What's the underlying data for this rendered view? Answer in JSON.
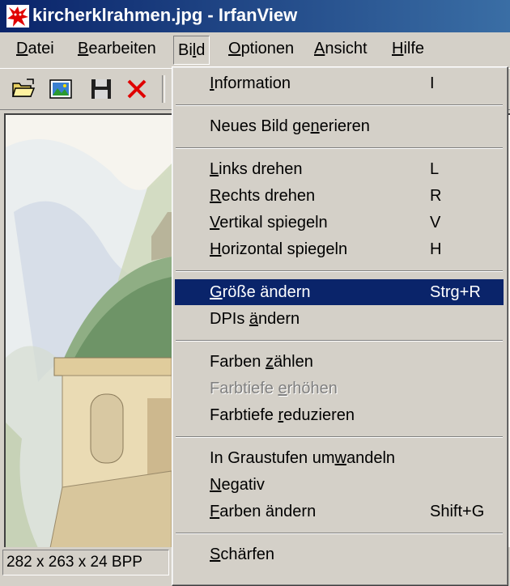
{
  "window": {
    "title": "kircherklrahmen.jpg - IrfanView",
    "icon": "irfanview-red-cat-icon"
  },
  "menubar": [
    {
      "label": "Datei",
      "mnemonic": "D"
    },
    {
      "label": "Bearbeiten",
      "mnemonic": "B"
    },
    {
      "label": "Bild",
      "mnemonic": "l",
      "open": true
    },
    {
      "label": "Optionen",
      "mnemonic": "O"
    },
    {
      "label": "Ansicht",
      "mnemonic": "A"
    },
    {
      "label": "Hilfe",
      "mnemonic": "H"
    }
  ],
  "toolbar": {
    "icons": [
      "open-folder-icon",
      "slideshow-icon",
      "save-disk-icon",
      "delete-x-icon"
    ]
  },
  "statusbar": {
    "info": "282 x 263 x 24 BPP"
  },
  "bild_menu": {
    "items": [
      {
        "label": "Information",
        "shortcut": "I",
        "mnemonic_index": 0
      },
      {
        "separator": true
      },
      {
        "label": "Neues Bild generieren",
        "shortcut": "",
        "mnemonic_index": 13
      },
      {
        "separator": true
      },
      {
        "label": "Links drehen",
        "shortcut": "L",
        "mnemonic_index": 0
      },
      {
        "label": "Rechts drehen",
        "shortcut": "R",
        "mnemonic_index": 0
      },
      {
        "label": "Vertikal spiegeln",
        "shortcut": "V",
        "mnemonic_index": 0
      },
      {
        "label": "Horizontal spiegeln",
        "shortcut": "H",
        "mnemonic_index": 0
      },
      {
        "separator": true
      },
      {
        "label": "Größe ändern",
        "shortcut": "Strg+R",
        "mnemonic_index": 0,
        "highlighted": true
      },
      {
        "label": "DPIs ändern",
        "shortcut": "",
        "mnemonic_index": 5
      },
      {
        "separator": true
      },
      {
        "label": "Farben zählen",
        "shortcut": "",
        "mnemonic_index": 7
      },
      {
        "label": "Farbtiefe erhöhen",
        "shortcut": "",
        "mnemonic_index": 10,
        "disabled": true
      },
      {
        "label": "Farbtiefe reduzieren",
        "shortcut": "",
        "mnemonic_index": 10
      },
      {
        "separator": true
      },
      {
        "label": "In Graustufen umwandeln",
        "shortcut": "",
        "mnemonic_index": 16
      },
      {
        "label": "Negativ",
        "shortcut": "",
        "mnemonic_index": 0
      },
      {
        "label": "Farben ändern",
        "shortcut": "Shift+G",
        "mnemonic_index": 0
      },
      {
        "separator": true
      },
      {
        "label": "Schärfen",
        "shortcut": "",
        "mnemonic_index": 0
      }
    ]
  },
  "colors": {
    "titlebar_start": "#0a246a",
    "titlebar_end": "#3a6ea5",
    "highlight": "#0a246a",
    "face": "#d4d0c8",
    "disabled_text": "#808080"
  }
}
